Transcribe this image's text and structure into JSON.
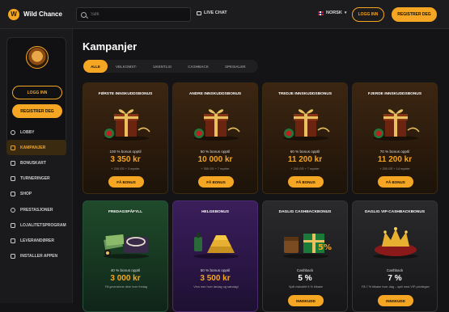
{
  "header": {
    "brand": "Wild Chance",
    "search_placeholder": "Søk",
    "live_chat": "LIVE CHAT",
    "language": "NORSK",
    "login": "LOGG INN",
    "register": "REGISTRER DEG"
  },
  "sidebar": {
    "login": "LOGG INN",
    "register": "REGISTRER DEG",
    "items": [
      {
        "label": "LOBBY",
        "icon": "lobby-icon"
      },
      {
        "label": "KAMPANJER",
        "icon": "gift-icon",
        "active": true
      },
      {
        "label": "BONUSKART",
        "icon": "map-icon"
      },
      {
        "label": "TURNERINGER",
        "icon": "trophy-icon"
      },
      {
        "label": "SHOP",
        "icon": "shop-icon"
      },
      {
        "label": "PRESTASJONER",
        "icon": "medal-icon"
      },
      {
        "label": "LOJALITETSPROGRAM",
        "icon": "crown-icon"
      },
      {
        "label": "LEVERANDØRER",
        "icon": "grid-icon"
      },
      {
        "label": "INSTALLER APPEN",
        "icon": "download-icon"
      }
    ]
  },
  "main": {
    "title": "Kampanjer",
    "tabs": [
      "ALLE",
      "VELKOMST-",
      "UKENTLIG",
      "CASHBACK",
      "SPESIALER"
    ],
    "cards_row1": [
      {
        "title": "FØRSTE INNSKUDDSBONUS",
        "desc": "100 % bonus opptil",
        "amount": "3 350 kr",
        "sub": "+ 200 GS + 3 mynter",
        "button": "FÅ BONUS"
      },
      {
        "title": "ANDRE INNSKUDDSBONUS",
        "desc": "50 % bonus opptil",
        "amount": "10 000 kr",
        "sub": "+ 300 GS + 7 mynter",
        "button": "FÅ BONUS"
      },
      {
        "title": "TREDJE INNSKUDDSBONUS",
        "desc": "60 % bonus opptil",
        "amount": "11 200 kr",
        "sub": "+ 200 GS + 7 mynter",
        "button": "FÅ BONUS"
      },
      {
        "title": "FJERDE INNSKUDDSBONUS",
        "desc": "70 % bonus opptil",
        "amount": "11 200 kr",
        "sub": "+ 200 GS + 14 mynter",
        "button": "FÅ BONUS"
      }
    ],
    "cards_row2": [
      {
        "title": "FREDAGSPÅFYLL",
        "desc": "40 % bonus opptil",
        "amount": "3 000 kr",
        "sub": "Få gevinstene dine hver fredag"
      },
      {
        "title": "HELGEBONUS",
        "desc": "50 % bonus opptil",
        "amount": "3 500 kr",
        "sub": "Vinn mer hver lørdag og søndag!"
      },
      {
        "title": "DAGLIG CASHBACKBONUS",
        "desc": "Cashback",
        "amount": "5 %",
        "sub": "Spill risikofritt 5 % tilbake",
        "button": "INNSKUDD"
      },
      {
        "title": "DAGLIG VIP-CASHBACKBONUS",
        "desc": "Cashback",
        "amount": "7 %",
        "sub": "Få 7 % tilbake hver dag – spill med VIP-privilegier",
        "button": "INNSKUDD"
      }
    ]
  },
  "colors": {
    "accent": "#f5a623",
    "bg": "#141416"
  }
}
